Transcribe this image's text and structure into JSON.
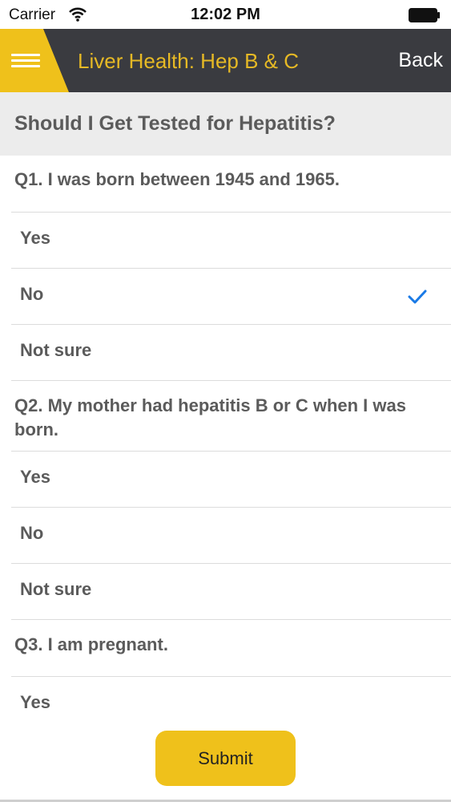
{
  "status_bar": {
    "carrier": "Carrier",
    "time": "12:02 PM"
  },
  "nav": {
    "title": "Liver Health: Hep B & C",
    "back_label": "Back",
    "menu_icon": "hamburger-menu-icon"
  },
  "section": {
    "title": "Should I Get Tested for Hepatitis?"
  },
  "questions": [
    {
      "text": "Q1. I was born between 1945 and 1965.",
      "options": [
        {
          "label": "Yes",
          "selected": false
        },
        {
          "label": "No",
          "selected": true
        },
        {
          "label": "Not sure",
          "selected": false
        }
      ]
    },
    {
      "text": "Q2. My mother had hepatitis B or C when I was born.",
      "options": [
        {
          "label": "Yes",
          "selected": false
        },
        {
          "label": "No",
          "selected": false
        },
        {
          "label": "Not sure",
          "selected": false
        }
      ]
    },
    {
      "text": "Q3. I am pregnant.",
      "options": [
        {
          "label": "Yes",
          "selected": false
        }
      ]
    }
  ],
  "submit_label": "Submit",
  "colors": {
    "accent": "#efc11b",
    "nav_bg": "#3a3b40",
    "check": "#1a7ae6"
  }
}
